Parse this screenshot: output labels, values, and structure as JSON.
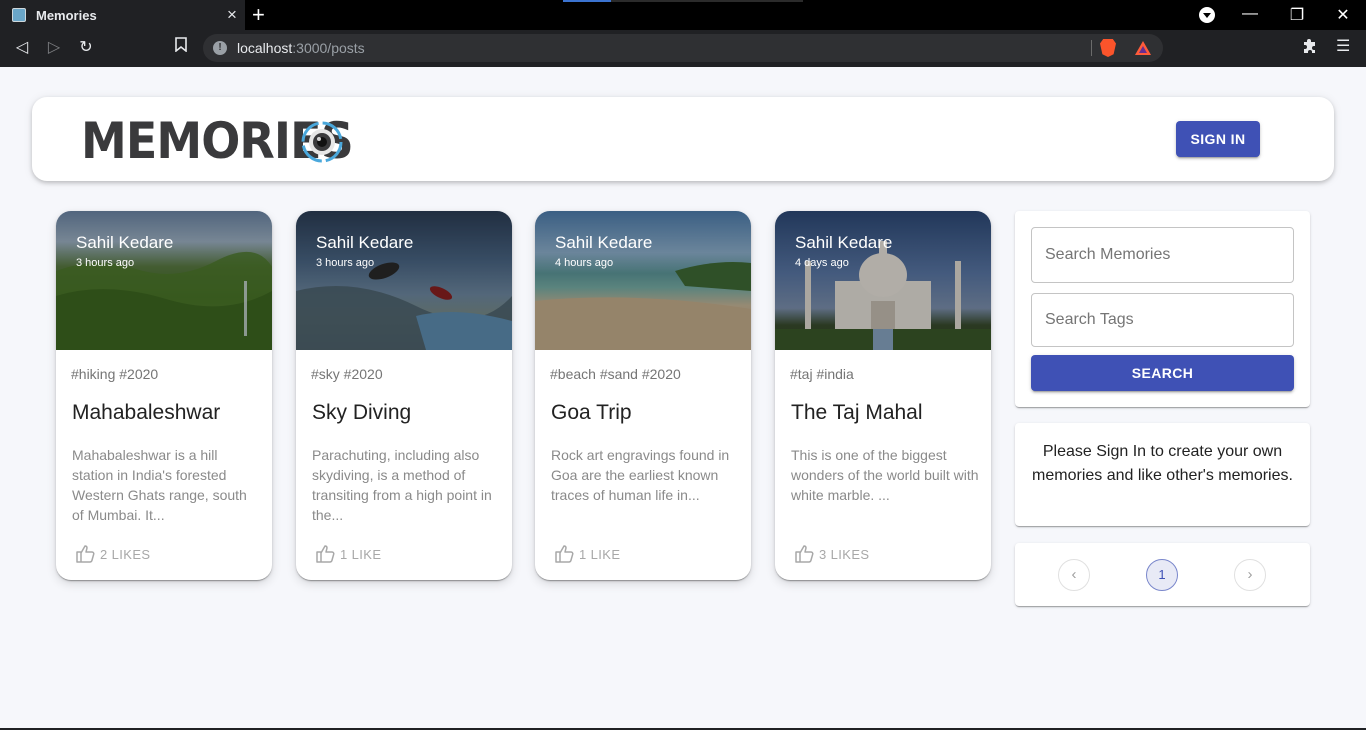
{
  "browser": {
    "tab_title": "Memories",
    "tab_close": "×",
    "new_tab": "+",
    "url_host": "localhost",
    "url_rest": ":3000/posts",
    "icons": [
      "back-icon",
      "forward-icon",
      "reload-icon",
      "bookmark-icon",
      "site-info-icon",
      "brave-shields-icon",
      "brave-rewards-icon",
      "extensions-icon",
      "menu-icon",
      "minimize-icon",
      "maximize-icon",
      "close-icon"
    ]
  },
  "header": {
    "logo_text": "MEMORIES",
    "signin_label": "SIGN IN"
  },
  "posts": [
    {
      "author": "Sahil Kedare",
      "time": "3 hours ago",
      "tags": "#hiking #2020",
      "title": "Mahabaleshwar",
      "message": "Mahabaleshwar is a hill station in India's forested Western Ghats range, south of Mumbai. It...",
      "likes": "2 LIKES",
      "image": "green hills with waterfall"
    },
    {
      "author": "Sahil Kedare",
      "time": "3 hours ago",
      "tags": "#sky #2020",
      "title": "Sky Diving",
      "message": "Parachuting, including also skydiving, is a method of transiting from a high point in the...",
      "likes": "1 LIKE",
      "image": "skydivers over mountains and lake"
    },
    {
      "author": "Sahil Kedare",
      "time": "4 hours ago",
      "tags": "#beach #sand #2020",
      "title": "Goa Trip",
      "message": "Rock art engravings found in Goa are the earliest known traces of human life in...",
      "likes": "1 LIKE",
      "image": "sandy beach with sea"
    },
    {
      "author": "Sahil Kedare",
      "time": "4 days ago",
      "tags": "#taj #india",
      "title": "The Taj Mahal",
      "message": "This is one of the biggest wonders of the world built with white marble. ...",
      "likes": "3 LIKES",
      "image": "Taj Mahal with reflecting pool"
    }
  ],
  "search": {
    "memories_placeholder": "Search Memories",
    "tags_placeholder": "Search Tags",
    "button_label": "SEARCH"
  },
  "notice": {
    "text": "Please Sign In to create your own memories and like other's memories."
  },
  "pagination": {
    "prev": "‹",
    "current": "1",
    "next": "›"
  },
  "colors": {
    "primary": "#3f51b5",
    "background": "#f6f7fb"
  }
}
